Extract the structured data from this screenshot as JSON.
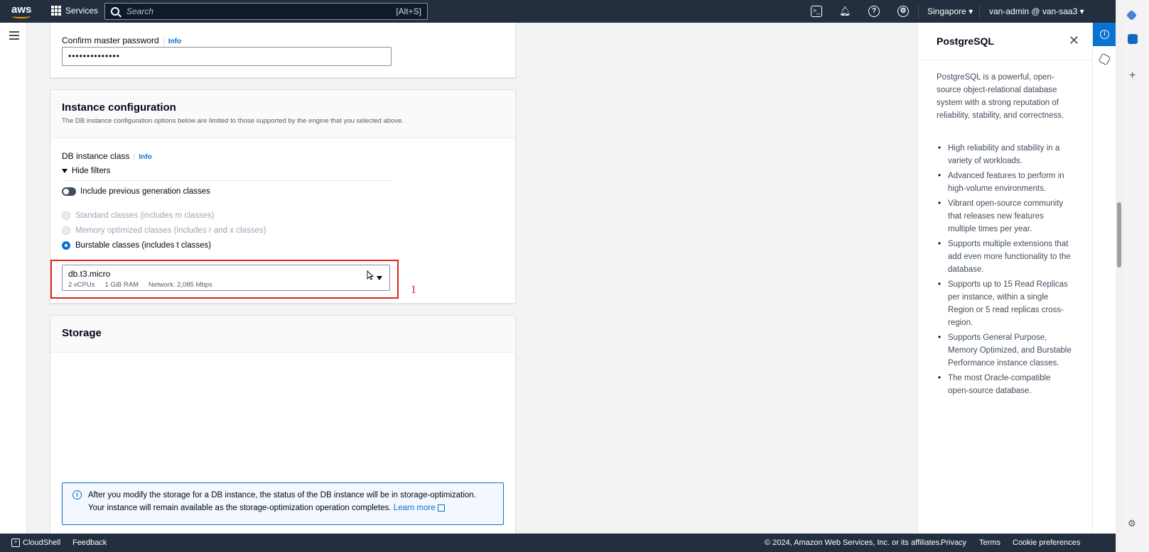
{
  "topnav": {
    "logo_text": "aws",
    "services_label": "Services",
    "search_placeholder": "Search",
    "search_shortcut": "[Alt+S]",
    "region": "Singapore",
    "account": "van-admin @ van-saa3"
  },
  "credentials": {
    "confirm_password_label": "Confirm master password",
    "info_label": "Info",
    "confirm_password_value": "••••••••••••••"
  },
  "instance_config": {
    "title": "Instance configuration",
    "description": "The DB instance configuration options below are limited to those supported by the engine that you selected above.",
    "class_label": "DB instance class",
    "info_label": "Info",
    "hide_filters_label": "Hide filters",
    "include_prev_gen_label": "Include previous generation classes",
    "class_options": [
      {
        "label": "Standard classes (includes m classes)",
        "state": "disabled"
      },
      {
        "label": "Memory optimized classes (includes r and x classes)",
        "state": "disabled"
      },
      {
        "label": "Burstable classes (includes t classes)",
        "state": "checked"
      }
    ],
    "selected_class": {
      "value": "db.t3.micro",
      "vcpus": "2 vCPUs",
      "ram": "1 GiB RAM",
      "network": "Network: 2,085 Mbps"
    },
    "annotation_number": "1"
  },
  "storage": {
    "title": "Storage",
    "alert_line1": "After you modify the storage for a DB instance, the status of the DB instance will be in storage-optimization.",
    "alert_line2": "Your instance will remain available as the storage-optimization operation completes.",
    "learn_more": "Learn more"
  },
  "help_panel": {
    "title": "PostgreSQL",
    "intro": "PostgreSQL is a powerful, open-source object-relational database system with a strong reputation of reliability, stability, and correctness.",
    "bullets": [
      "High reliability and stability in a variety of workloads.",
      "Advanced features to perform in high-volume environments.",
      "Vibrant open-source community that releases new features multiple times per year.",
      "Supports multiple extensions that add even more functionality to the database.",
      "Supports up to 15 Read Replicas per instance, within a single Region or 5 read replicas cross-region.",
      "Supports General Purpose, Memory Optimized, and Burstable Performance instance classes.",
      "The most Oracle-compatible open-source database."
    ]
  },
  "footer": {
    "cloudshell": "CloudShell",
    "feedback": "Feedback",
    "copyright": "© 2024, Amazon Web Services, Inc. or its affiliates.",
    "privacy": "Privacy",
    "terms": "Terms",
    "cookie": "Cookie preferences"
  },
  "colors": {
    "nav_bg": "#232f3e",
    "accent": "#0972d3",
    "annotation_red": "#e0231b"
  }
}
